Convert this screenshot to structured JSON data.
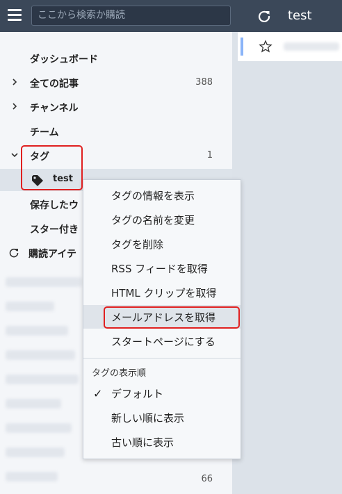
{
  "header": {
    "search_placeholder": "ここから検索か購読",
    "title": "test"
  },
  "sidebar": {
    "items": [
      {
        "label": "ダッシュボード",
        "count": ""
      },
      {
        "label": "全ての記事",
        "count": "388"
      },
      {
        "label": "チャンネル",
        "count": ""
      },
      {
        "label": "チーム",
        "count": ""
      },
      {
        "label": "タグ",
        "count": "1"
      },
      {
        "label": "test",
        "count": ""
      },
      {
        "label": "保存したウ",
        "count": ""
      },
      {
        "label": "スター付き",
        "count": ""
      },
      {
        "label": "購読アイテ",
        "count": ""
      }
    ],
    "bottom_count": "66"
  },
  "context_menu": {
    "items": [
      "タグの情報を表示",
      "タグの名前を変更",
      "タグを削除",
      "RSS フィードを取得",
      "HTML クリップを取得",
      "メールアドレスを取得",
      "スタートページにする"
    ],
    "section_title": "タグの表示順",
    "sort_items": [
      "デフォルト",
      "新しい順に表示",
      "古い順に表示"
    ]
  },
  "colors": {
    "header_bg": "#3b4859",
    "highlight": "#e02020",
    "accent": "#8ab4f8"
  }
}
